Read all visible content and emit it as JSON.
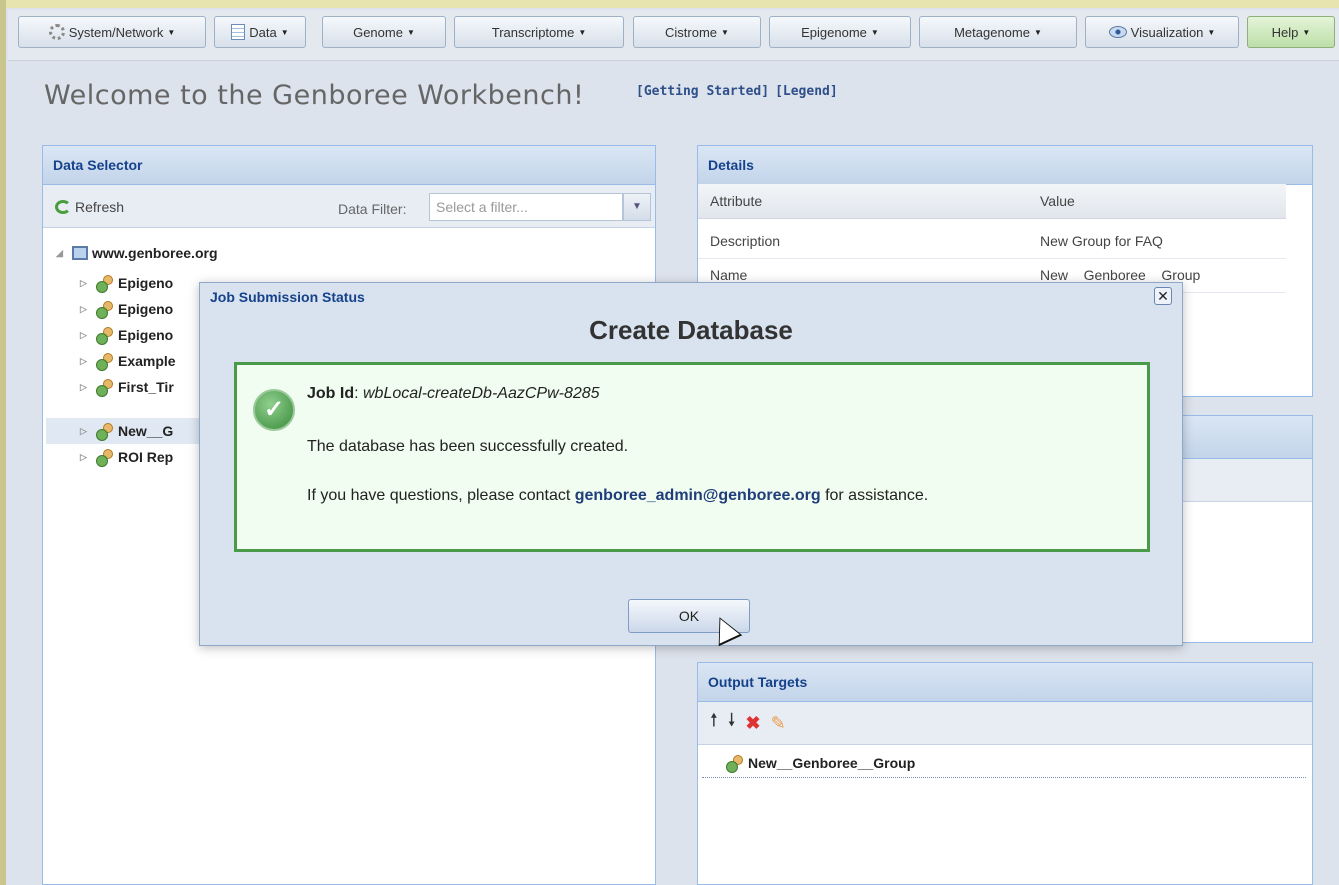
{
  "toolbar": {
    "items": [
      {
        "label": "System/Network",
        "icon": "gear-icon"
      },
      {
        "label": "Data",
        "icon": "document-icon"
      },
      {
        "label": "Genome"
      },
      {
        "label": "Transcriptome"
      },
      {
        "label": "Cistrome"
      },
      {
        "label": "Epigenome"
      },
      {
        "label": "Metagenome"
      },
      {
        "label": "Visualization",
        "icon": "eye-icon"
      },
      {
        "label": "Help"
      }
    ]
  },
  "welcome": {
    "title": "Welcome to the Genboree Workbench!",
    "links": [
      "[Getting Started]",
      "[Legend]"
    ]
  },
  "data_selector": {
    "title": "Data Selector",
    "refresh_label": "Refresh",
    "filter_label": "Data Filter:",
    "filter_placeholder": "Select a filter...",
    "root": "www.genboree.org",
    "items": [
      "Epigeno",
      "Epigeno",
      "Epigeno",
      "Example",
      "First_Tir",
      "New__G",
      "ROI Rep"
    ]
  },
  "details": {
    "title": "Details",
    "columns": [
      "Attribute",
      "Value"
    ],
    "rows": [
      {
        "attr": "Description",
        "value": "New Group for FAQ"
      },
      {
        "attr": "Name",
        "value": "New__Genboree__Group"
      }
    ]
  },
  "output_targets": {
    "title": "Output Targets",
    "item": "New__Genboree__Group"
  },
  "modal": {
    "title": "Job Submission Status",
    "heading": "Create Database",
    "job_id_label": "Job Id",
    "job_id_value": "wbLocal-createDb-AazCPw-8285",
    "message": "The database has been successfully created.",
    "contact_prefix": "If you have questions, please contact",
    "contact_email": "genboree_admin@genboree.org",
    "contact_suffix": "for assistance.",
    "ok_label": "OK"
  }
}
